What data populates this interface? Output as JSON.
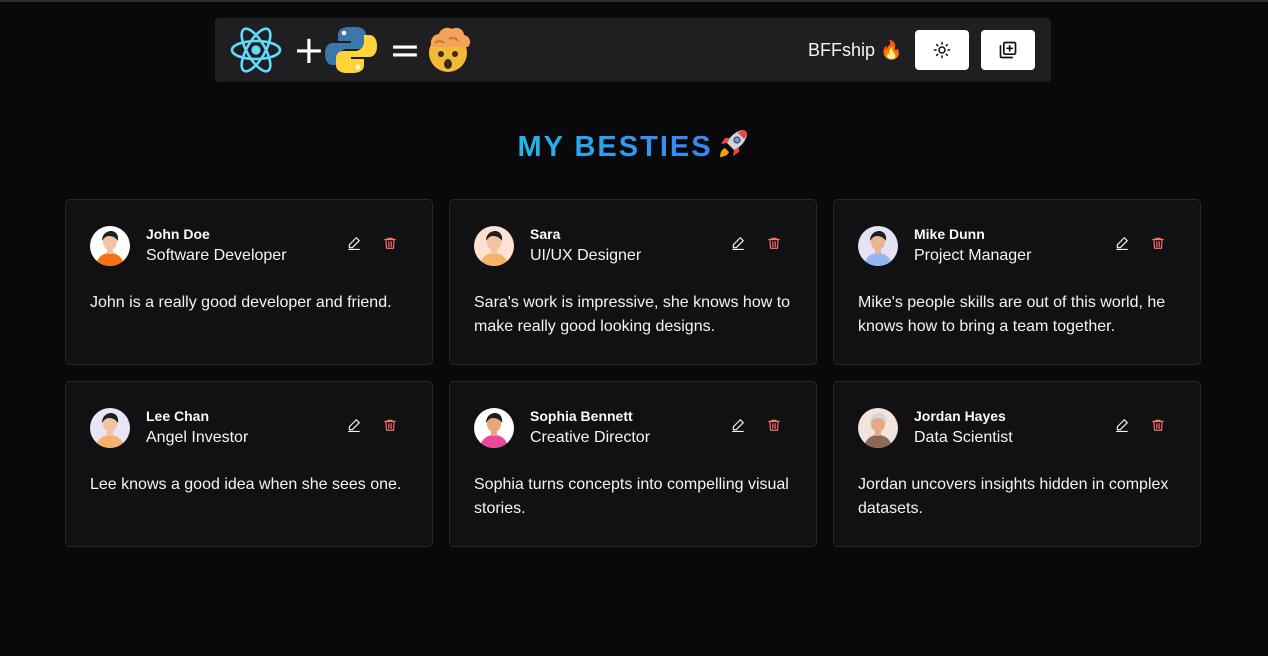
{
  "navbar": {
    "plus_symbol": "+",
    "equals_symbol": "=",
    "brand": "BFFship 🔥",
    "theme_toggle_icon": "sun-icon",
    "add_friend_icon": "add-square-icon"
  },
  "page": {
    "title": "MY BESTIES",
    "title_emoji": "rocket-icon"
  },
  "colors": {
    "background": "#09090b",
    "card": "#111113",
    "accent_start": "#22b8e8",
    "accent_end": "#3b82f6",
    "delete": "#f87171"
  },
  "friends": [
    {
      "name": "John Doe",
      "role": "Software Developer",
      "description": "John is a really good developer and friend.",
      "avatar_bg": "#ffffff",
      "avatar_shirt": "#f97316",
      "avatar_hair": "#1f1f1f",
      "avatar_skin": "#f2c4a3"
    },
    {
      "name": "Sara",
      "role": "UI/UX Designer",
      "description": "Sara's work is impressive, she knows how to make really good looking designs.",
      "avatar_bg": "#fde2d1",
      "avatar_shirt": "#f5b26b",
      "avatar_hair": "#1f1f1f",
      "avatar_skin": "#f2c4a3"
    },
    {
      "name": "Mike Dunn",
      "role": "Project Manager",
      "description": "Mike's people skills are out of this world, he knows how to bring a team together.",
      "avatar_bg": "#e6e2f5",
      "avatar_shirt": "#93b7f0",
      "avatar_hair": "#1f1f1f",
      "avatar_skin": "#e9b48f"
    },
    {
      "name": "Lee Chan",
      "role": "Angel Investor",
      "description": "Lee knows a good idea when she sees one.",
      "avatar_bg": "#e9e4f7",
      "avatar_shirt": "#f4b16a",
      "avatar_hair": "#1f1f1f",
      "avatar_skin": "#f2c4a3"
    },
    {
      "name": "Sophia Bennett",
      "role": "Creative Director",
      "description": "Sophia turns concepts into compelling visual stories.",
      "avatar_bg": "#ffffff",
      "avatar_shirt": "#ec4899",
      "avatar_hair": "#1f1f1f",
      "avatar_skin": "#e9a67c"
    },
    {
      "name": "Jordan Hayes",
      "role": "Data Scientist",
      "description": "Jordan uncovers insights hidden in complex datasets.",
      "avatar_bg": "#f3e3dc",
      "avatar_shirt": "#8a6a55",
      "avatar_hair": "#d6d6d6",
      "avatar_skin": "#e2a98a"
    }
  ]
}
